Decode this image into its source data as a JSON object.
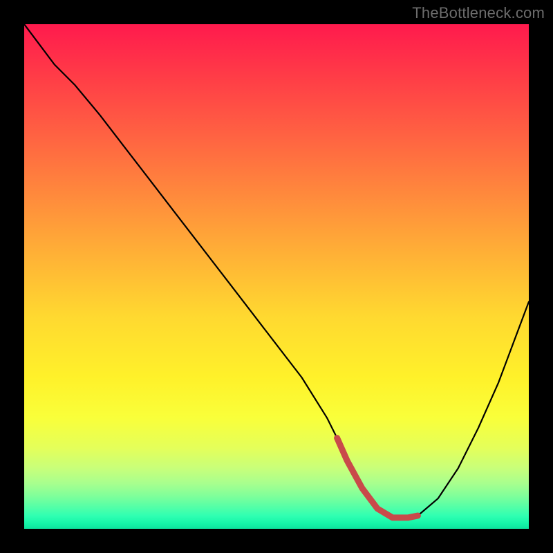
{
  "watermark": "TheBottleneck.com",
  "colors": {
    "curve": "#000000",
    "trough": "#c94a4a",
    "frame": "#000000"
  },
  "chart_data": {
    "type": "line",
    "title": "",
    "xlabel": "",
    "ylabel": "",
    "xlim": [
      0,
      100
    ],
    "ylim": [
      0,
      100
    ],
    "grid": false,
    "legend": false,
    "description": "Bottleneck curve: vertical-gradient background from red (top, high bottleneck) through orange/yellow to green (bottom, no bottleneck). Black curve descends from top-left to a flat trough near the bottom-right-center, then rises toward the right edge. The trough segment is overdrawn in muted red.",
    "series": [
      {
        "name": "bottleneck",
        "x": [
          0,
          3,
          6,
          10,
          15,
          20,
          25,
          30,
          35,
          40,
          45,
          50,
          55,
          60,
          62,
          64,
          67,
          70,
          73,
          76,
          78,
          82,
          86,
          90,
          94,
          97,
          100
        ],
        "values": [
          100,
          96,
          92,
          88,
          82,
          75.5,
          69,
          62.5,
          56,
          49.5,
          43,
          36.5,
          30,
          22,
          18,
          13.5,
          8,
          4,
          2.2,
          2.2,
          2.6,
          6,
          12,
          20,
          29,
          37,
          45
        ]
      }
    ],
    "trough_highlight": {
      "x": [
        62,
        64,
        67,
        70,
        73,
        76,
        78
      ],
      "values": [
        18,
        13.5,
        8,
        4,
        2.2,
        2.2,
        2.6
      ]
    }
  }
}
